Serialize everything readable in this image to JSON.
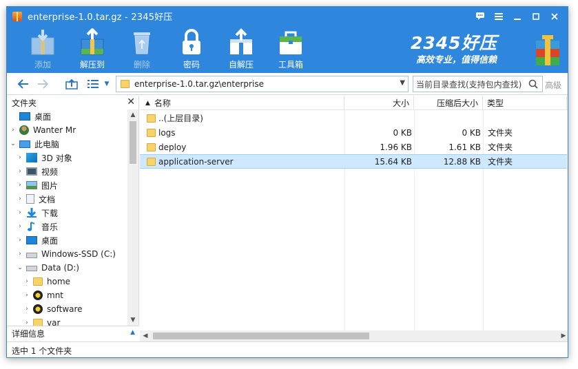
{
  "window": {
    "title": "enterprise-1.0.tar.gz - 2345好压"
  },
  "toolbar": {
    "buttons": [
      {
        "label": "添加",
        "icon": "add-archive-icon",
        "enabled": false
      },
      {
        "label": "解压到",
        "icon": "extract-to-icon",
        "enabled": true
      },
      {
        "label": "删除",
        "icon": "trash-icon",
        "enabled": false
      },
      {
        "label": "密码",
        "icon": "lock-icon",
        "enabled": true
      },
      {
        "label": "自解压",
        "icon": "self-extract-icon",
        "enabled": true
      },
      {
        "label": "工具箱",
        "icon": "toolbox-icon",
        "enabled": true
      }
    ],
    "logo_main": "2345好压",
    "logo_sub": "高效专业，值得信赖"
  },
  "address": {
    "path": "enterprise-1.0.tar.gz\\enterprise",
    "search_placeholder": "当前目录查找(支持包内查找)",
    "advanced_label": "高级"
  },
  "tree": {
    "header": "文件夹",
    "items": [
      {
        "label": "桌面",
        "icon": "desktop-icon",
        "level": 0,
        "toggle": ""
      },
      {
        "label": "Wanter Mr",
        "icon": "user-folder-icon",
        "level": 0,
        "toggle": "›"
      },
      {
        "label": "此电脑",
        "icon": "computer-icon",
        "level": 0,
        "toggle": "⌄"
      },
      {
        "label": "3D 对象",
        "icon": "objects-3d-icon",
        "level": 1,
        "toggle": "›"
      },
      {
        "label": "视频",
        "icon": "video-icon",
        "level": 1,
        "toggle": "›"
      },
      {
        "label": "图片",
        "icon": "pictures-icon",
        "level": 1,
        "toggle": "›"
      },
      {
        "label": "文档",
        "icon": "documents-icon",
        "level": 1,
        "toggle": "›"
      },
      {
        "label": "下载",
        "icon": "download-icon",
        "level": 1,
        "toggle": "›"
      },
      {
        "label": "音乐",
        "icon": "music-icon",
        "level": 1,
        "toggle": "›"
      },
      {
        "label": "桌面",
        "icon": "desktop-icon",
        "level": 1,
        "toggle": "›"
      },
      {
        "label": "Windows-SSD (C:)",
        "icon": "windows-drive-icon",
        "level": 1,
        "toggle": "›"
      },
      {
        "label": "Data (D:)",
        "icon": "drive-icon",
        "level": 1,
        "toggle": "⌄"
      },
      {
        "label": "home",
        "icon": "folder-icon",
        "level": 2,
        "toggle": "›"
      },
      {
        "label": "mnt",
        "icon": "mnt-folder-icon",
        "level": 2,
        "toggle": "›"
      },
      {
        "label": "software",
        "icon": "mnt-folder-icon",
        "level": 2,
        "toggle": "›"
      },
      {
        "label": "var",
        "icon": "folder-icon",
        "level": 2,
        "toggle": "›"
      }
    ],
    "detail_label": "详细信息"
  },
  "list": {
    "columns": {
      "name": "名称",
      "size": "大小",
      "packed": "压缩后大小",
      "type": "类型"
    },
    "rows": [
      {
        "name": "..(上层目录)",
        "size": "",
        "packed": "",
        "type": "",
        "selected": false
      },
      {
        "name": "logs",
        "size": "0 KB",
        "packed": "0 KB",
        "type": "文件夹",
        "selected": false
      },
      {
        "name": "deploy",
        "size": "1.96 KB",
        "packed": "1.61 KB",
        "type": "文件夹",
        "selected": false
      },
      {
        "name": "application-server",
        "size": "15.64 KB",
        "packed": "12.88 KB",
        "type": "文件夹",
        "selected": true
      }
    ]
  },
  "status": {
    "text": "选中 1 个文件夹"
  }
}
